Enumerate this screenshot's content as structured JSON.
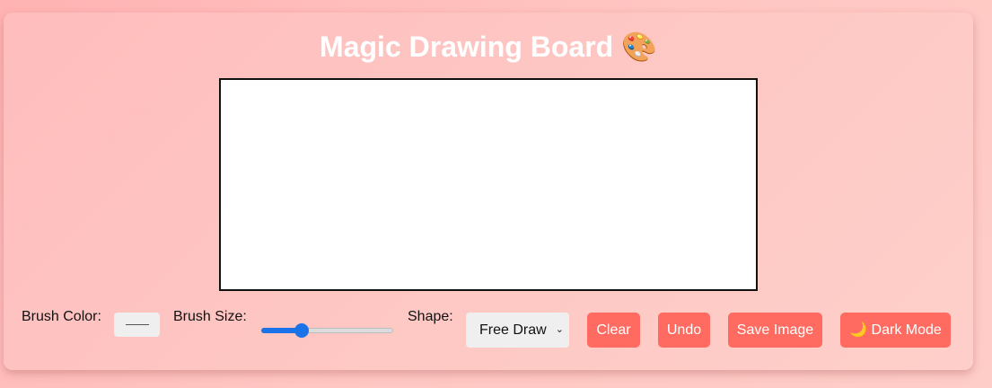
{
  "title": "Magic Drawing Board 🎨",
  "controls": {
    "brush_color_label": "Brush Color:",
    "brush_color_value": "#555555",
    "brush_size_label": "Brush Size:",
    "brush_size_fraction": 0.28,
    "shape_label": "Shape:",
    "shape_selected": "Free Draw",
    "shape_chevron": "⌄"
  },
  "buttons": {
    "clear": "Clear",
    "undo": "Undo",
    "save": "Save Image",
    "dark_mode": "🌙 Dark Mode"
  },
  "colors": {
    "accent_button": "#ff6b61",
    "slider": "#1a73e8",
    "canvas": "#ffffff"
  }
}
